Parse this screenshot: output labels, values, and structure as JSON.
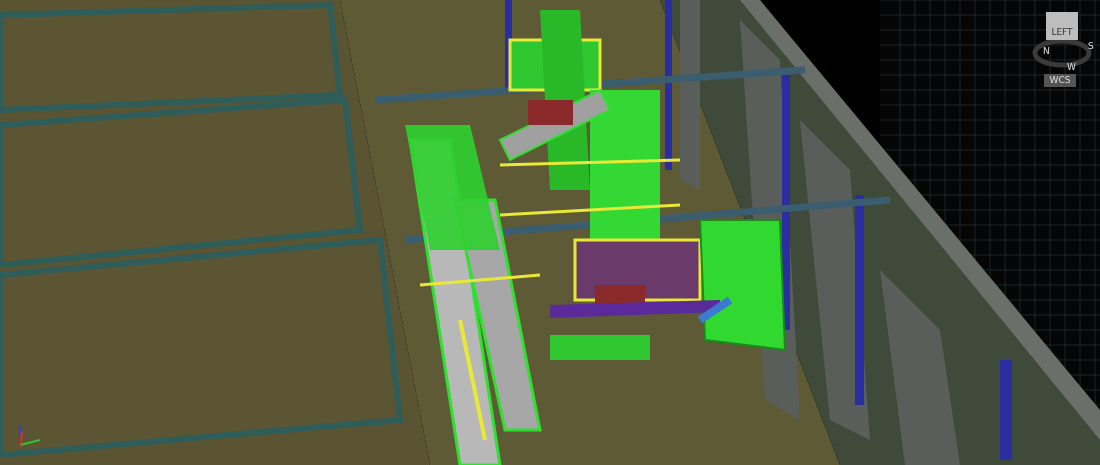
{
  "viewport": {
    "view_cube": {
      "face": "LEFT",
      "compass": [
        {
          "label": "N"
        },
        {
          "label": "S"
        },
        {
          "label": "W"
        }
      ],
      "coordinate_system": "WCS"
    }
  }
}
